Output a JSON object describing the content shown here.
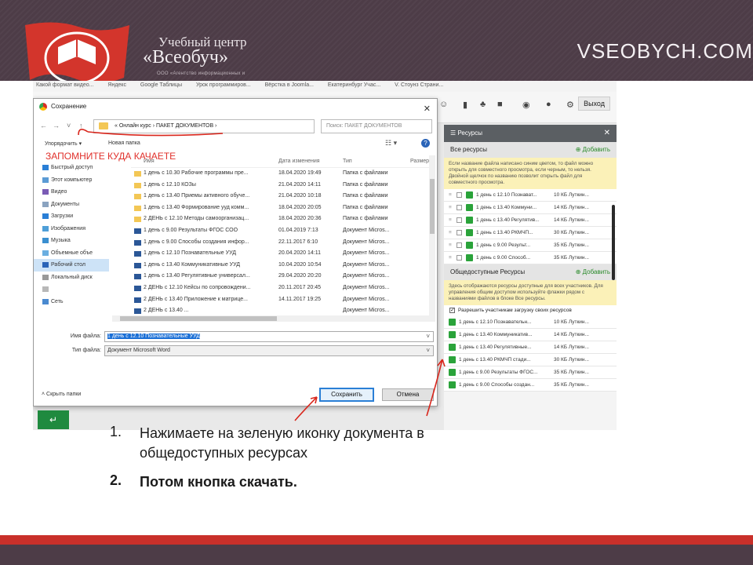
{
  "branding": {
    "line1": "Учебный центр",
    "line2": "«Всеобуч»",
    "line3": "ООО «Агентство информационных и",
    "site": "VSEOBYCH.COM",
    "colors": {
      "header_bg": "#4d3c47",
      "logo_red": "#d3352c",
      "footer_red": "#c9302a"
    }
  },
  "browser": {
    "bookmarks": [
      "Какой формат видео...",
      "Яндекс",
      "Google Таблицы",
      "Урок программиров...",
      "Вёрстка в Joomla...",
      "Екатеринбург Учас...",
      "V. Стоунз Страни..."
    ],
    "exit_label": "Выход"
  },
  "dialog": {
    "title": "Сохранение",
    "address": "«  Онлайн курс  ›  ПАКЕТ ДОКУМЕНТОВ  ›",
    "search_placeholder": "Поиск: ПАКЕТ ДОКУМЕНТОВ",
    "organize_label": "Упорядочить ▾",
    "new_folder_label": "Новая папка",
    "note": "ЗАПОМНИТЕ КУДА КАЧАЕТЕ",
    "nav_items": [
      "Быстрый доступ",
      "Этот компьютер",
      "Видео",
      "Документы",
      "Загрузки",
      "Изображения",
      "Музыка",
      "Объемные объе",
      "Рабочий стол",
      "Локальный диск",
      "",
      "Сеть"
    ],
    "columns": {
      "name": "Имя",
      "date": "Дата изменения",
      "type": "Тип",
      "size": "Размер"
    },
    "files": [
      {
        "name": "1 день с 10.30 Рабочие программы пре...",
        "date": "18.04.2020 19:49",
        "type": "Папка с файлами",
        "size": "",
        "icon": "folder"
      },
      {
        "name": "1 день с 12.10 КОЗы",
        "date": "21.04.2020 14:11",
        "type": "Папка с файлами",
        "size": "",
        "icon": "folder"
      },
      {
        "name": "1 день с 13.40 Приемы активного обуче...",
        "date": "21.04.2020 10:18",
        "type": "Папка с файлами",
        "size": "",
        "icon": "folder"
      },
      {
        "name": "1 день с 13.40 Формирование ууд комм...",
        "date": "18.04.2020 20:05",
        "type": "Папка с файлами",
        "size": "",
        "icon": "folder"
      },
      {
        "name": "2 ДЕНЬ с 12.10 Методы самоорганизац...",
        "date": "18.04.2020 20:36",
        "type": "Папка с файлами",
        "size": "",
        "icon": "folder"
      },
      {
        "name": "1 день с 9.00 Результаты ФГОС СОО",
        "date": "01.04.2019 7:13",
        "type": "Документ Micros...",
        "size": "",
        "icon": "doc"
      },
      {
        "name": "1 день с 9.00 Способы создания инфор...",
        "date": "22.11.2017 6:10",
        "type": "Документ Micros...",
        "size": "",
        "icon": "doc"
      },
      {
        "name": "1 день с 12.10 Познавательные УУД",
        "date": "20.04.2020 14:11",
        "type": "Документ Micros...",
        "size": "",
        "icon": "doc"
      },
      {
        "name": "1 день с 13.40 Коммуникативные УУД",
        "date": "10.04.2020 10:54",
        "type": "Документ Micros...",
        "size": "",
        "icon": "doc"
      },
      {
        "name": "1 день с 13.40 Регулятивные универсал...",
        "date": "29.04.2020 20:20",
        "type": "Документ Micros...",
        "size": "",
        "icon": "doc"
      },
      {
        "name": "2 ДЕНЬ с 12.10 Кейсы по сопровождени...",
        "date": "20.11.2017 20:45",
        "type": "Документ Micros...",
        "size": "",
        "icon": "doc"
      },
      {
        "name": "2 ДЕНЬ с 13.40 Приложение к матрице...",
        "date": "14.11.2017 19:25",
        "type": "Документ Micros...",
        "size": "",
        "icon": "doc"
      },
      {
        "name": "2 ДЕНЬ с 13.40 ...",
        "date": "",
        "type": "Документ Micros...",
        "size": "",
        "icon": "doc"
      }
    ],
    "filename_label": "Имя файла:",
    "filename_value": "1 день с 12.10 Познавательные УУД",
    "filetype_label": "Тип файла:",
    "filetype_value": "Документ Microsoft Word",
    "hide_folders_label": "Скрыть папки",
    "save_label": "Сохранить",
    "cancel_label": "Отмена"
  },
  "resources": {
    "title": "Ресурсы",
    "all_section": "Все ресурсы",
    "add_label": "Добавить",
    "all_info": "Если название файла написано синим цветом, то файл можно открыть для совместного просмотра, если черным, то нельзя. Двойной щелчок по названию позволит открыть файл для совместного просмотра.",
    "all_items": [
      {
        "name": "1 день с 12.10 Познават...",
        "size": "10 КБ Луткин..."
      },
      {
        "name": "1 день с 13.40 Коммуни...",
        "size": "14 КБ Луткин..."
      },
      {
        "name": "1 день с 13.40 Регулятив...",
        "size": "14 КБ Луткин..."
      },
      {
        "name": "1 день с 13.40 РКМЧП...",
        "size": "30 КБ Луткин..."
      },
      {
        "name": "1 день с 9.00 Результ...",
        "size": "35 КБ Луткин..."
      },
      {
        "name": "1 день с 9.00 Способ...",
        "size": "35 КБ Луткин..."
      }
    ],
    "public_section": "Общедоступные Ресурсы",
    "public_info": "Здесь отображаются ресурсы доступные для всех участников. Для управления общим доступом используйте флажки рядом с названиями файлов в блоке Все ресурсы.",
    "allow_upload_label": "Разрешить участникам загрузку своих ресурсов",
    "public_items": [
      {
        "name": "1 день с 12.10 Познавательн...",
        "size": "10 КБ Луткин..."
      },
      {
        "name": "1 день с 13.40 Коммуникатив...",
        "size": "14 КБ Луткин..."
      },
      {
        "name": "1 день с 13.40 Регулятивные...",
        "size": "14 КБ Луткин..."
      },
      {
        "name": "1 день с 13.40 РКМЧП стади...",
        "size": "30 КБ Луткин..."
      },
      {
        "name": "1 день с 9.00 Результаты ФГОС...",
        "size": "35 КБ Луткин..."
      },
      {
        "name": "1 день с 9.00 Способы создан...",
        "size": "35 КБ Луткин..."
      }
    ]
  },
  "instructions": [
    {
      "num": "1.",
      "text": "Нажимаете на зеленую иконку документа в общедоступных ресурсах"
    },
    {
      "num": "2.",
      "text": "Потом кнопка скачать."
    }
  ]
}
